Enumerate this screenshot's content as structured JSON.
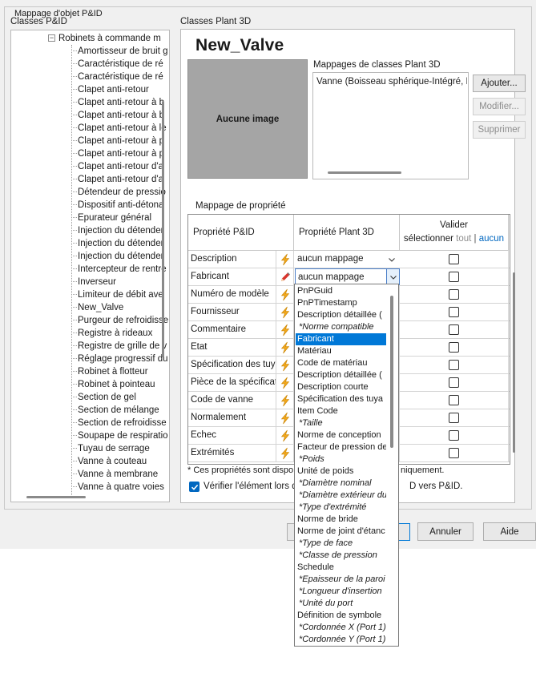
{
  "dialog": {
    "group_title": "Mappage d'objet P&ID",
    "left_label": "Classes P&ID",
    "right_label": "Classes Plant 3D"
  },
  "tree": {
    "root": "Robinets à commande m",
    "items": [
      "Amortisseur de bruit g",
      "Caractéristique de ré",
      "Caractéristique de ré",
      "Clapet anti-retour",
      "Clapet anti-retour à b",
      "Clapet anti-retour à b",
      "Clapet anti-retour à le",
      "Clapet anti-retour à p",
      "Clapet anti-retour à p",
      "Clapet anti-retour d'a",
      "Clapet anti-retour d'a",
      "Détendeur de pressio",
      "Dispositif anti-détona",
      "Epurateur général",
      "Injection du détender",
      "Injection du détender",
      "Injection du détender",
      "Intercepteur de rentre",
      "Inverseur",
      "Limiteur de débit ave",
      "New_Valve",
      "Purgeur de refroidisse",
      "Registre à rideaux",
      "Registre de grille de v",
      "Réglage progressif du",
      "Robinet à flotteur",
      "Robinet à pointeau",
      "Section de gel",
      "Section de mélange",
      "Section de refroidisse",
      "Soupape de respiratio",
      "Tuyau de serrage",
      "Vanne à couteau",
      "Vanne à membrane",
      "Vanne à quatre voies"
    ]
  },
  "class": {
    "title": "New_Valve",
    "no_image": "Aucune image",
    "mappings_label": "Mappages de classes Plant 3D",
    "mappings": [
      "Vanne (Boisseau sphérique-Intégré, Bois"
    ],
    "add_button": "Ajouter...",
    "modify_button": "Modifier...",
    "delete_button": "Supprimer"
  },
  "property": {
    "section_label": "Mappage de propriété",
    "col_pid": "Propriété P&ID",
    "col_plant": "Propriété Plant 3D",
    "col_validate": "Valider",
    "select_label": "sélectionner",
    "select_all": "tout",
    "select_none": "aucun",
    "rows": [
      {
        "name": "Description",
        "value": "aucun mappage"
      },
      {
        "name": "Fabricant",
        "value": "aucun mappage"
      },
      {
        "name": "Numéro de modèle",
        "value": ""
      },
      {
        "name": "Fournisseur",
        "value": ""
      },
      {
        "name": "Commentaire",
        "value": ""
      },
      {
        "name": "Etat",
        "value": ""
      },
      {
        "name": "Spécification des tuya",
        "value": ""
      },
      {
        "name": "Pièce de la spécificat",
        "value": ""
      },
      {
        "name": "Code de vanne",
        "value": ""
      },
      {
        "name": "Normalement",
        "value": ""
      },
      {
        "name": "Echec",
        "value": ""
      },
      {
        "name": "Extrémités",
        "value": ""
      }
    ],
    "footnote": "* Ces propriétés sont dispo",
    "footnote_tail": "niquement.",
    "verify_label": "Vérifier l'élément lors d",
    "verify_tail": "D vers P&ID."
  },
  "dropdown": {
    "selected": "Fabricant",
    "options": [
      {
        "label": "PnPGuid",
        "italic": false
      },
      {
        "label": "PnPTimestamp",
        "italic": false
      },
      {
        "label": "Description détaillée (",
        "italic": false
      },
      {
        "label": "*Norme compatible",
        "italic": true
      },
      {
        "label": "Fabricant",
        "italic": false
      },
      {
        "label": "Matériau",
        "italic": false
      },
      {
        "label": "Code de matériau",
        "italic": false
      },
      {
        "label": "Description détaillée (",
        "italic": false
      },
      {
        "label": "Description courte",
        "italic": false
      },
      {
        "label": "Spécification des tuya",
        "italic": false
      },
      {
        "label": "Item Code",
        "italic": false
      },
      {
        "label": "*Taille",
        "italic": true
      },
      {
        "label": "Norme de conception",
        "italic": false
      },
      {
        "label": "Facteur de pression de",
        "italic": false
      },
      {
        "label": "*Poids",
        "italic": true
      },
      {
        "label": "Unité de poids",
        "italic": false
      },
      {
        "label": "*Diamètre nominal",
        "italic": true
      },
      {
        "label": "*Diamètre extérieur du",
        "italic": true
      },
      {
        "label": "*Type d'extrémité",
        "italic": true
      },
      {
        "label": "Norme de bride",
        "italic": false
      },
      {
        "label": "Norme de joint d'étanc",
        "italic": false
      },
      {
        "label": "*Type de face",
        "italic": true
      },
      {
        "label": "*Classe de pression",
        "italic": true
      },
      {
        "label": "Schedule",
        "italic": false
      },
      {
        "label": "*Epaisseur de la paroi",
        "italic": true
      },
      {
        "label": "*Longueur d'insertion",
        "italic": true
      },
      {
        "label": "*Unité du port",
        "italic": true
      },
      {
        "label": "Définition de symbole",
        "italic": false
      },
      {
        "label": "*Cordonnée X (Port 1)",
        "italic": true
      },
      {
        "label": "*Cordonnée Y (Port 1)",
        "italic": true
      }
    ]
  },
  "footer": {
    "cancel_button": "Annuler",
    "help_button": "Aide"
  },
  "colors": {
    "accent": "#0078d7",
    "link": "#0067c0",
    "lightning": "#f2a81d",
    "pencil": "#d8342c"
  }
}
